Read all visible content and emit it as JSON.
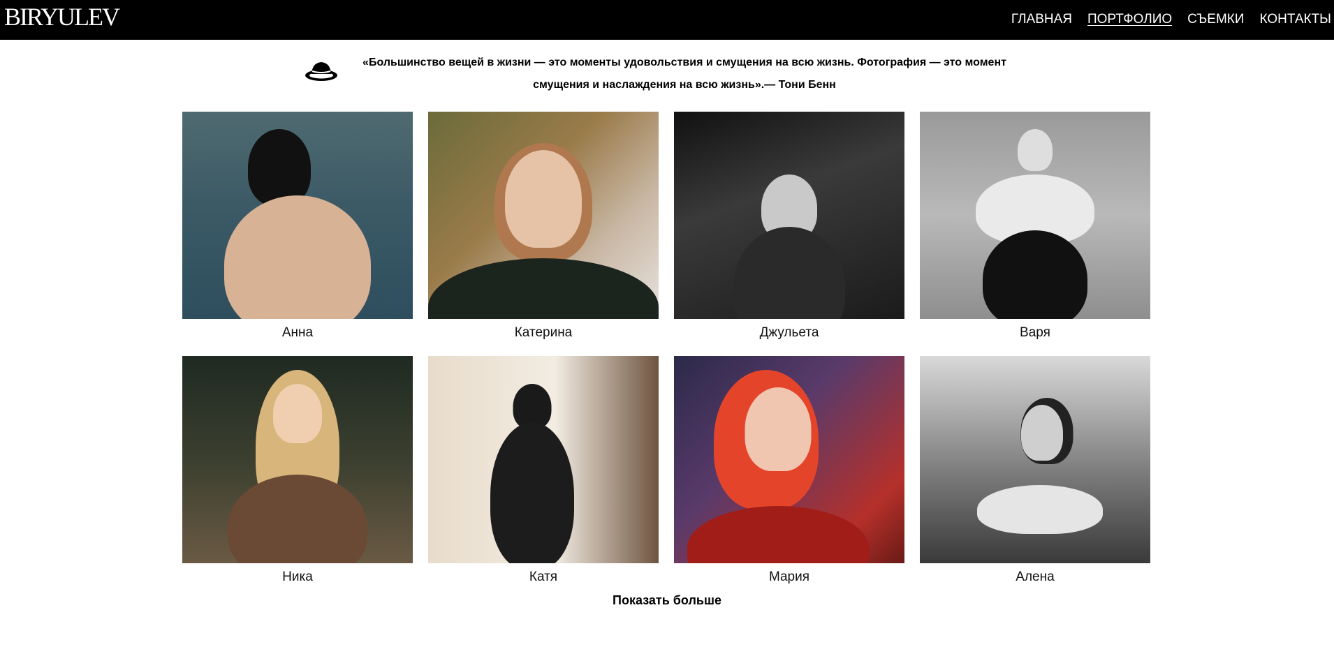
{
  "header": {
    "logo": "BIRYULEV",
    "nav": [
      {
        "label": "ГЛАВНАЯ",
        "active": false
      },
      {
        "label": "ПОРТФОЛИО",
        "active": true
      },
      {
        "label": "СЪЕМКИ",
        "active": false
      },
      {
        "label": "КОНТАКТЫ",
        "active": false
      }
    ]
  },
  "quote": {
    "icon": "hat-icon",
    "line1": "«Большинство вещей в жизни — это моменты удовольствия и смущения на  всю жизнь. Фотография — это момент",
    "line2": "смущения и наслаждения на всю жизнь».— Тони Бенн"
  },
  "gallery": [
    {
      "name": "Анна"
    },
    {
      "name": "Катерина"
    },
    {
      "name": "Джульета"
    },
    {
      "name": "Варя"
    },
    {
      "name": "Ника"
    },
    {
      "name": "Катя"
    },
    {
      "name": "Мария"
    },
    {
      "name": "Алена"
    }
  ],
  "show_more_label": "Показать больше",
  "colors": {
    "header_bg": "#000000",
    "page_bg": "#ffffff",
    "text": "#000000"
  }
}
